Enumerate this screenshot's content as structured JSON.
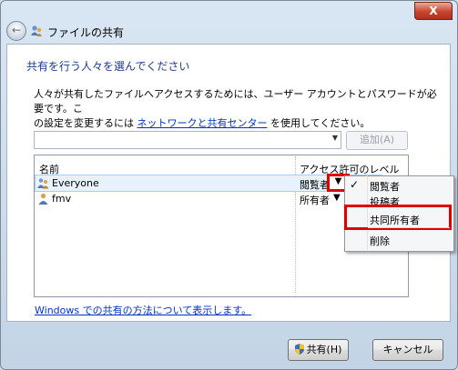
{
  "window": {
    "title": "ファイルの共有",
    "close_label": "X"
  },
  "main": {
    "heading": "共有を行う人々を選んでください",
    "description_1": "人々が共有したファイルへアクセスするためには、ユーザー アカウントとパスワードが必要です。こ",
    "description_2_prefix": "の設定を変更するには ",
    "description_link": "ネットワークと共有センター",
    "description_2_suffix": " を使用してください。",
    "combo_value": "",
    "add_button": "追加(A)"
  },
  "list": {
    "col_name": "名前",
    "col_level": "アクセス許可のレベル",
    "rows": [
      {
        "name": "Everyone",
        "level": "閲覧者",
        "icon": "group-icon",
        "selected": true
      },
      {
        "name": "fmv",
        "level": "所有者",
        "icon": "user-icon",
        "selected": false
      }
    ]
  },
  "menu": {
    "items": [
      {
        "label": "閲覧者",
        "checked": true
      },
      {
        "label": "投稿者",
        "checked": false
      },
      {
        "label": "共同所有者",
        "checked": false
      },
      {
        "label": "削除",
        "checked": false
      }
    ]
  },
  "footer": {
    "help_link": "Windows での共有の方法について表示します。",
    "share_button": "共有(H)",
    "cancel_button": "キャンセル"
  },
  "colors": {
    "highlight": "#e00000",
    "link": "#0033cc",
    "heading": "#1e3a9a"
  }
}
